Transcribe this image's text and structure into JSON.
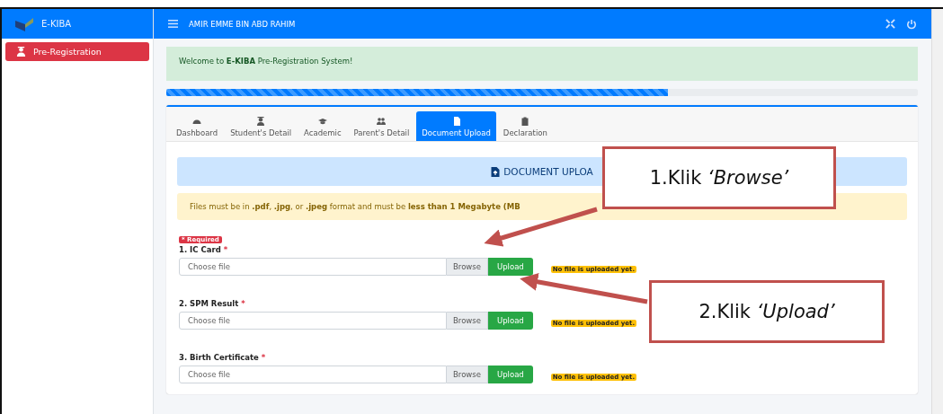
{
  "app": {
    "name": "E-KIBA",
    "user": "AMIR EMME BIN ABD RAHIM"
  },
  "sidebar": {
    "items": [
      {
        "label": "Pre-Registration",
        "selected": true
      }
    ]
  },
  "welcome": "Welcome to **E-KIBA** Pre-Registration System!",
  "progress": {
    "level": 0.667
  },
  "tabs": [
    {
      "label": "Dashboard",
      "selected": false
    },
    {
      "label": "Student's Detail",
      "selected": false
    },
    {
      "label": "Academic",
      "selected": false
    },
    {
      "label": "Parent's Detail",
      "selected": false
    },
    {
      "label": "Document Upload",
      "selected": true
    },
    {
      "label": "Declaration",
      "selected": false
    }
  ],
  "section_title": "DOCUMENT UPLOA",
  "notice": "Files must be in **.pdf**, **.jpg**, or **.jpeg** format and must be **less than 1 Megabyte (MB**",
  "documents": [
    {
      "badge": "* Required",
      "label": "1. IC Card",
      "asterisk": "*",
      "placeholder": "Choose file",
      "browse": "Browse",
      "upload": "Upload",
      "status": "No file is uploaded yet."
    },
    {
      "label": "2. SPM Result",
      "asterisk": "*",
      "placeholder": "Choose file",
      "browse": "Browse",
      "upload": "Upload",
      "status": "No file is uploaded yet."
    },
    {
      "label": "3. Birth Certificate",
      "asterisk": "*",
      "placeholder": "Choose file",
      "browse": "Browse",
      "upload": "Upload",
      "status": "No file is uploaded yet."
    }
  ],
  "callouts": [
    "1.Klik *‘Browse’*",
    "2.Klik *‘Upload’*"
  ]
}
